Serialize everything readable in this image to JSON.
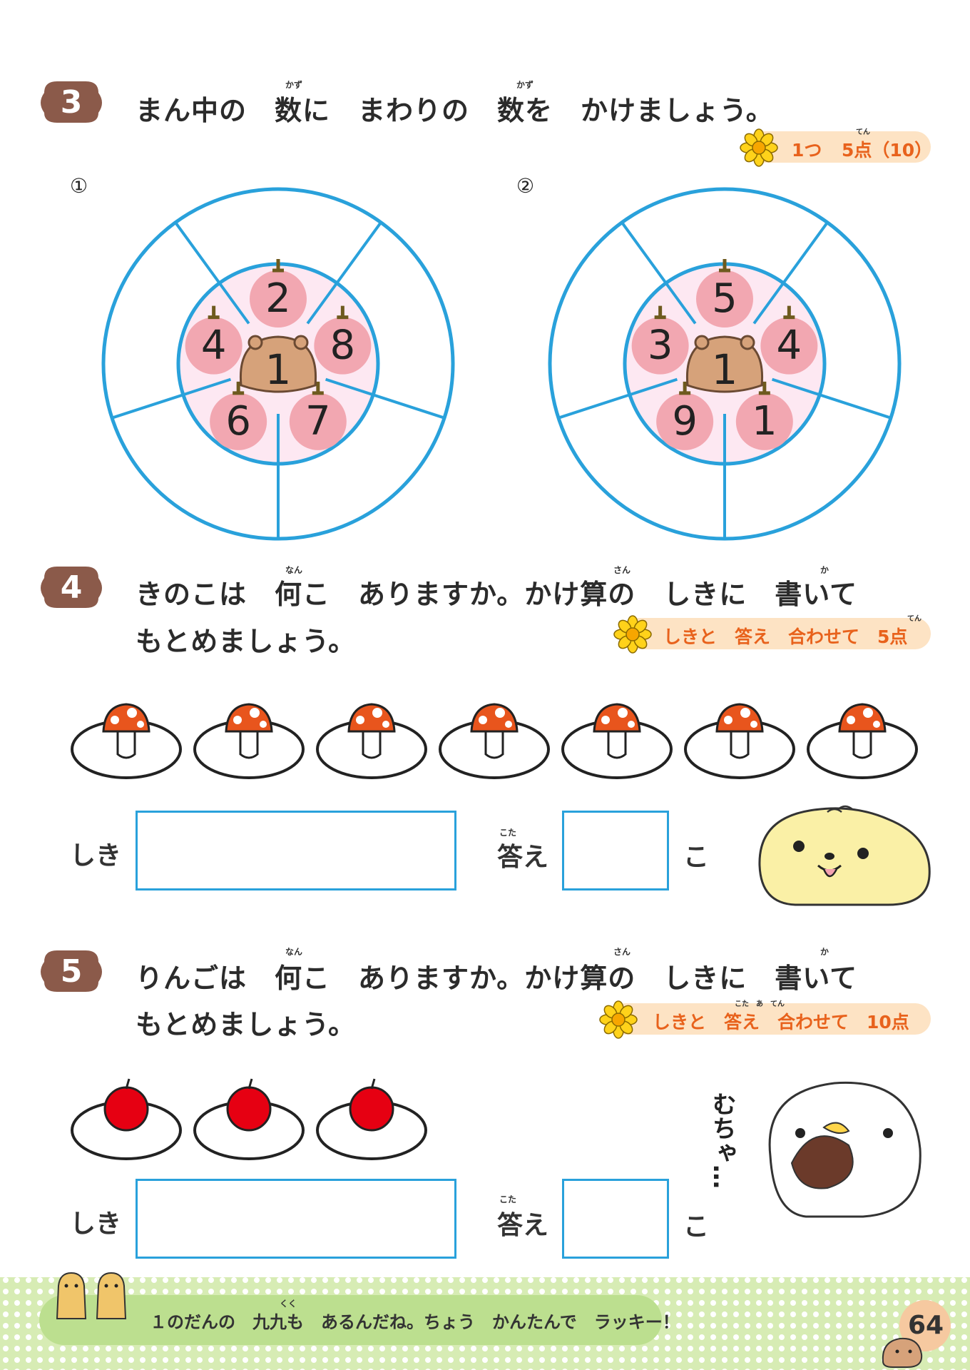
{
  "q3": {
    "number": "3",
    "text": "まん中の　数に　まわりの　数を　かけましょう。",
    "ruby": [
      "かず",
      "かず"
    ],
    "points_count": "1つ",
    "points_label": "5点（10）",
    "points_ruby": "てん",
    "wheels": [
      {
        "label": "①",
        "center": "1",
        "outer": [
          "2",
          "8",
          "7",
          "6",
          "4"
        ]
      },
      {
        "label": "②",
        "center": "1",
        "outer": [
          "5",
          "4",
          "1",
          "9",
          "3"
        ]
      }
    ]
  },
  "q4": {
    "number": "4",
    "line1": "きのこは　何こ　ありますか。かけ算の　しきに　書いて",
    "line2": "もとめましょう。",
    "ruby": [
      "なん",
      "さん",
      "か"
    ],
    "points_label": "しきと　答え　合わせて　5点",
    "points_ruby": "てん",
    "item_count": 7,
    "shiki_label": "しき",
    "kotae_label": "答え",
    "kotae_ruby": "こた",
    "unit": "こ"
  },
  "q5": {
    "number": "5",
    "line1": "りんごは　何こ　ありますか。かけ算の　しきに　書いて",
    "line2": "もとめましょう。",
    "ruby": [
      "なん",
      "さん",
      "か"
    ],
    "points_label": "しきと　答え　合わせて　10点",
    "points_ruby": "こた　あ　てん",
    "item_count": 3,
    "shiki_label": "しき",
    "kotae_label": "答え",
    "kotae_ruby": "こた",
    "unit": "こ",
    "speech": "むちゃ…"
  },
  "footer": {
    "text": "１のだんの　九九も　あるんだね。ちょう　かんたんで　ラッキー！",
    "ruby": "くく",
    "page_number": "64"
  },
  "colors": {
    "badge": "#8b5a4a",
    "blue": "#29a1db",
    "apple_pink": "#f2a7b1",
    "center_brown": "#d6a27a",
    "points_bg": "#fde3c4",
    "points_text": "#e8621c",
    "footer_green": "#bcdf8f"
  }
}
